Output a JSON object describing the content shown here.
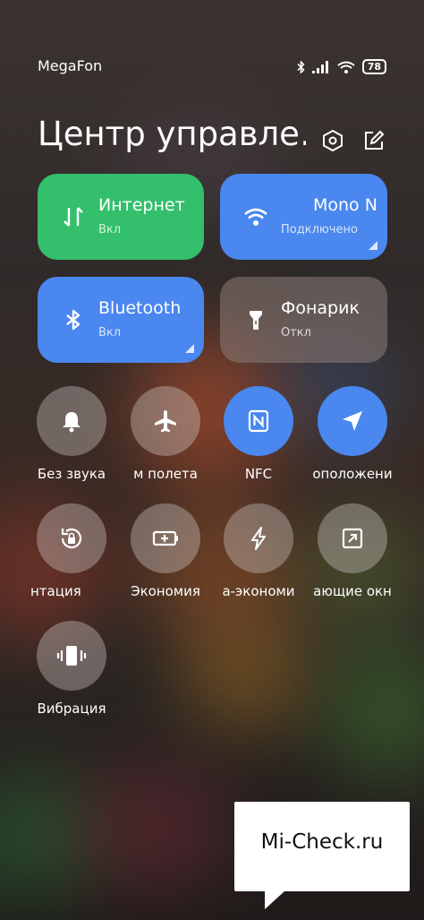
{
  "status_bar": {
    "carrier": "MegaFon",
    "battery": "78"
  },
  "header": {
    "title": "Центр управле…"
  },
  "tiles": [
    {
      "label": "Интернет",
      "sublabel": "Вкл",
      "icon": "data-transfer-icon",
      "color": "#33bf6b"
    },
    {
      "label": "Mono N",
      "sublabel": "Подключено",
      "icon": "wifi-icon",
      "color": "#4a87ee"
    },
    {
      "label": "Bluetooth",
      "sublabel": "Вкл",
      "icon": "bluetooth-icon",
      "color": "#4a87ee"
    },
    {
      "label": "Фонарик",
      "sublabel": "Откл",
      "icon": "flashlight-icon",
      "color": "#6e625d"
    }
  ],
  "toggles": [
    {
      "label": "Без звука",
      "icon": "bell-icon",
      "active": false
    },
    {
      "label": "м полета",
      "icon": "airplane-icon",
      "active": false
    },
    {
      "label": "NFC",
      "icon": "nfc-icon",
      "active": true
    },
    {
      "label": "оположени",
      "icon": "location-icon",
      "active": true
    },
    {
      "label": "нтация",
      "icon": "rotation-lock-icon",
      "active": false
    },
    {
      "label": "Экономия",
      "icon": "battery-saver-icon",
      "active": false
    },
    {
      "label": "а-экономи",
      "icon": "ultra-battery-saver-icon",
      "active": false
    },
    {
      "label": "ающие окн",
      "icon": "floating-window-icon",
      "active": false
    },
    {
      "label": "Вибрация",
      "icon": "vibration-icon",
      "active": false
    }
  ],
  "watermark": {
    "text": "Mi-Check.ru"
  }
}
